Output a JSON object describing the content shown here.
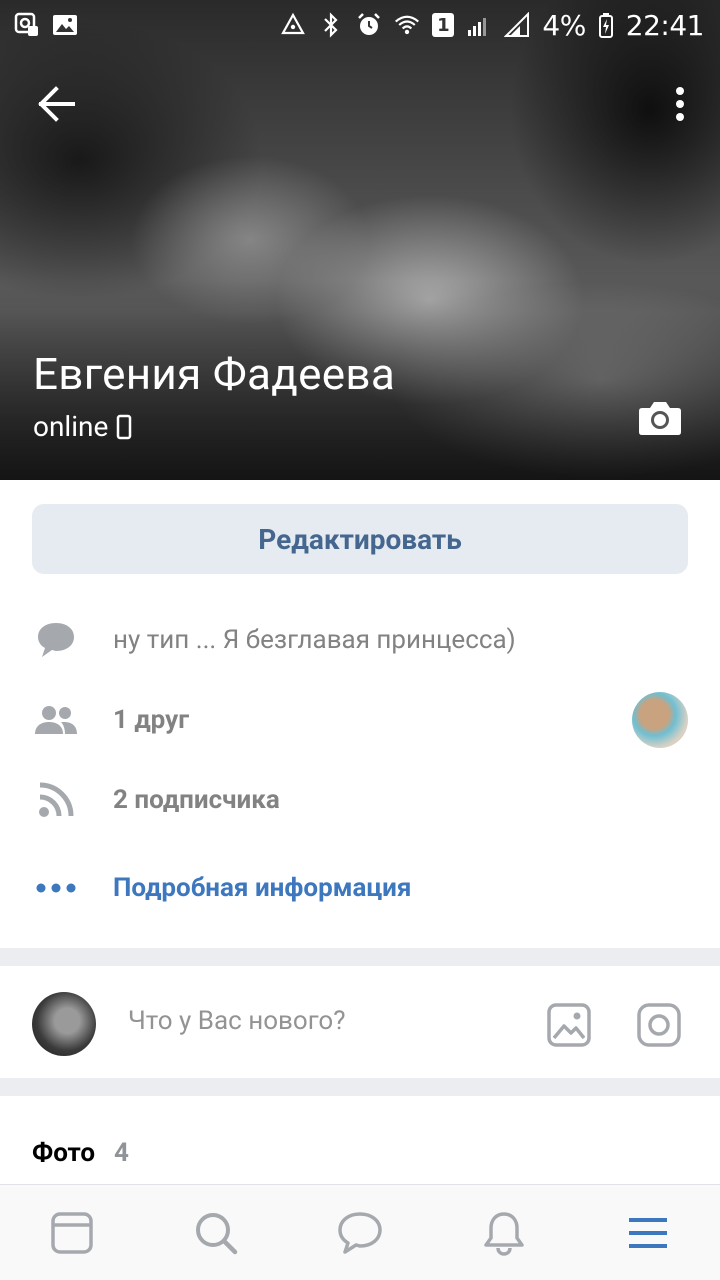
{
  "status_bar": {
    "battery_percent": "4%",
    "time": "22:41",
    "sim_slot": "1"
  },
  "profile": {
    "name": "Евгения Фадеева",
    "status": "online"
  },
  "actions": {
    "edit_label": "Редактировать"
  },
  "info": {
    "status_text": "ну тип ... Я безглавая принцесса)",
    "friends": "1 друг",
    "followers": "2 подписчика",
    "details_link": "Подробная информация"
  },
  "composer": {
    "placeholder": "Что у Вас нового?"
  },
  "photos": {
    "title": "Фото",
    "count": "4"
  },
  "colors": {
    "accent": "#3d77bd",
    "edit_button_bg": "#e5ebf1",
    "edit_button_text": "#45678f",
    "icon_grey": "#a5a9ae"
  },
  "bottom_nav": [
    "newsfeed-icon",
    "search-icon",
    "messages-icon",
    "notifications-icon",
    "menu-icon"
  ]
}
